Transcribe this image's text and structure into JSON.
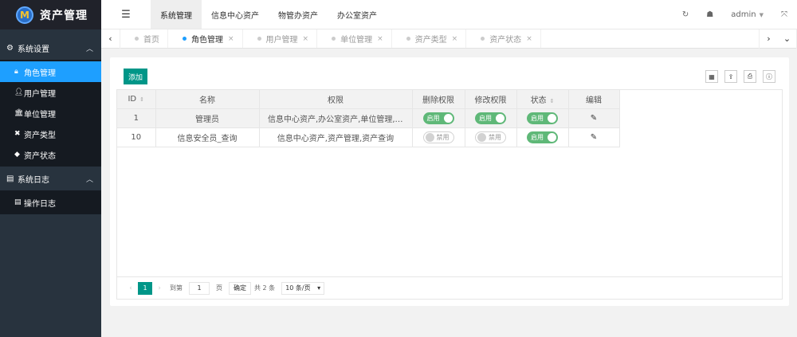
{
  "app": {
    "logo_mark": "M",
    "title": "资产管理"
  },
  "sidebar": {
    "groups": [
      {
        "label": "系统设置",
        "icon": "gears-icon",
        "items": [
          {
            "label": "角色管理",
            "icon": "lock-icon",
            "active": true
          },
          {
            "label": "用户管理",
            "icon": "user-icon"
          },
          {
            "label": "单位管理",
            "icon": "bank-icon"
          },
          {
            "label": "资产类型",
            "icon": "wrench-icon"
          },
          {
            "label": "资产状态",
            "icon": "cube-icon"
          }
        ]
      },
      {
        "label": "系统日志",
        "icon": "file-icon",
        "items": [
          {
            "label": "操作日志",
            "icon": "file-text-icon"
          }
        ]
      }
    ]
  },
  "topnav": {
    "tabs": [
      "系统管理",
      "信息中心资产",
      "物管办资产",
      "办公室资产"
    ],
    "active_tab": 0,
    "user": "admin"
  },
  "pagetabs": [
    {
      "label": "首页",
      "closable": false
    },
    {
      "label": "角色管理",
      "closable": true,
      "active": true
    },
    {
      "label": "用户管理",
      "closable": true
    },
    {
      "label": "单位管理",
      "closable": true
    },
    {
      "label": "资产类型",
      "closable": true
    },
    {
      "label": "资产状态",
      "closable": true
    }
  ],
  "toolbar": {
    "add_label": "添加"
  },
  "table": {
    "columns": [
      "ID",
      "名称",
      "权限",
      "删除权限",
      "修改权限",
      "状态",
      "编辑"
    ],
    "rows": [
      {
        "id": "1",
        "name": "管理员",
        "perm": "信息中心资产,办公室资产,单位管理,参数...",
        "del": "启用",
        "mod": "启用",
        "status": "启用"
      },
      {
        "id": "10",
        "name": "信息安全员_查询",
        "perm": "信息中心资产,资产管理,资产查询",
        "del": "禁用",
        "mod": "禁用",
        "status": "启用"
      }
    ]
  },
  "pager": {
    "current": "1",
    "goto_label": "到第",
    "goto_value": "1",
    "page_label": "页",
    "confirm": "确定",
    "total": "共 2 条",
    "per_page": "10 条/页"
  },
  "colors": {
    "sidebar_bg": "#28333e",
    "active_item": "#1e9fff",
    "primary": "#009688",
    "switch_on": "#5fb878"
  }
}
